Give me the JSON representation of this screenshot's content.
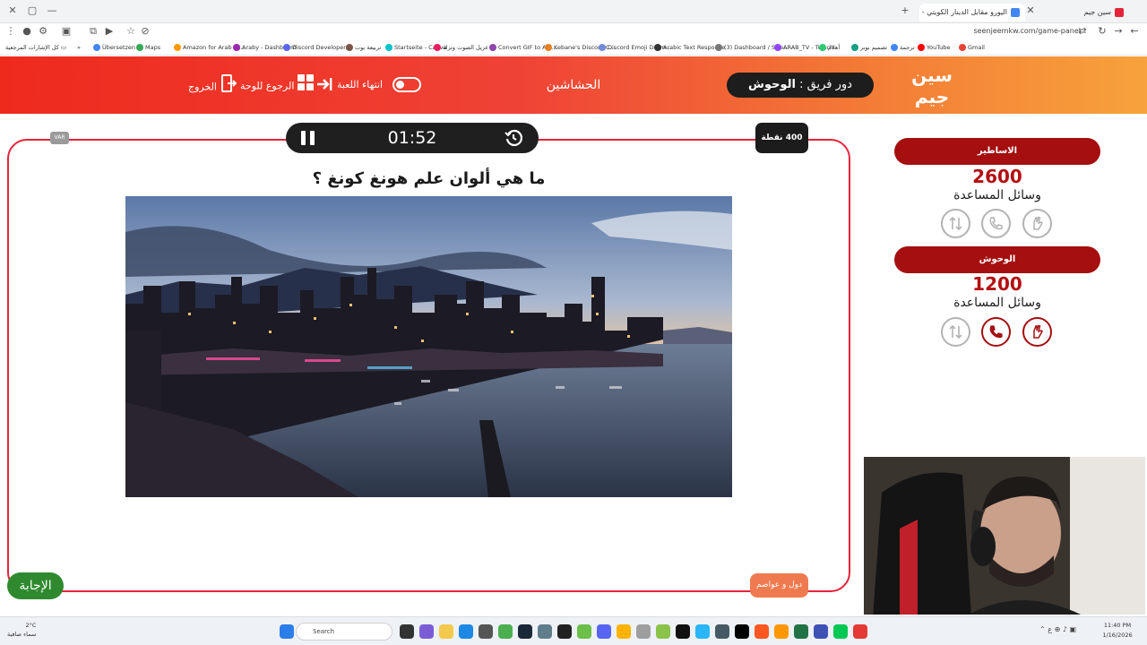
{
  "browser": {
    "tabs": [
      {
        "label": "سين جيم",
        "active": false
      },
      {
        "label": "اليورو مقابل الدينار الكويتي - بحث",
        "active": true
      }
    ],
    "url": "seenjeemkw.com/game-panel",
    "bookmarks_left": "كل الإشارات المرجعية",
    "bookmarks": [
      "Übersetzen",
      "Maps",
      "Amazon for Arab Ac...",
      "Araby - Dashboard",
      "Discord Developer...",
      "تربيعة بوت",
      "Startseite - Canva",
      "عزيل الصوت وتزلة ...",
      "Convert GIF to Ani...",
      "Kebane's Discord C...",
      "Discord Emoji Down...",
      "Arabic Text Response",
      "(3) Dashboard / Stre...",
      "ARAB_TV - Twitch",
      "أهلام",
      "تصميم بوبر",
      "ترجمة",
      "YouTube",
      "Gmail"
    ]
  },
  "header": {
    "logo_text": "سين جيم",
    "turn_prefix": "دور فريق :",
    "turn_team": "الوحوش",
    "game_title": "الحشاشين",
    "end_game_label": "انتهاء اللعبة",
    "back_label": "الرجوع للوحة",
    "exit_label": "الخروج"
  },
  "question": {
    "timer": "01:52",
    "points": "400 نقطة",
    "var_badge": "VAR",
    "text": "ما هي ألوان علم هونغ كونغ ؟",
    "answer_label": "الإجابة",
    "category_label": "دول و عواصم"
  },
  "teams": [
    {
      "name": "الاساطير",
      "score": "2600",
      "help_label": "وسائل المساعدة",
      "lifelines": [
        "hand",
        "phone",
        "swap"
      ],
      "lifelines_active": [
        false,
        false,
        false
      ]
    },
    {
      "name": "الوحوش",
      "score": "1200",
      "help_label": "وسائل المساعدة",
      "lifelines": [
        "hand",
        "phone",
        "swap"
      ],
      "lifelines_active": [
        true,
        true,
        false
      ]
    }
  ],
  "taskbar": {
    "weather_temp": "2°C",
    "weather_desc": "سماء صافية",
    "search_placeholder": "Search",
    "time": "11:40 PM",
    "date": "1/16/2026"
  },
  "colors": {
    "accent_red": "#e5243b",
    "team_red": "#a50f10",
    "answer_green": "#2f8a2f",
    "category_orange": "#f07a4f"
  }
}
